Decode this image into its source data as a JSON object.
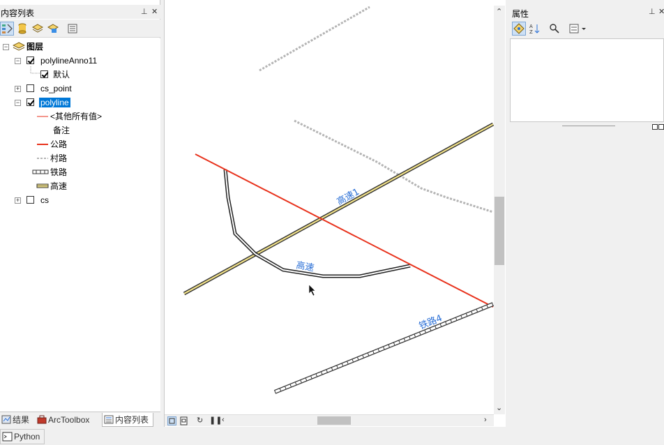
{
  "toc": {
    "title": "内容列表",
    "pin_glyph": "⊥",
    "close_glyph": "✕",
    "tree": {
      "root_label": "图层",
      "anno_layer": "polylineAnno11",
      "anno_class": "默认",
      "point_layer": "cs_point",
      "line_layer": "polyline",
      "legend": [
        {
          "label": "<其他所有值>",
          "style": "thin-red"
        },
        {
          "label": "备注",
          "style": "none"
        },
        {
          "label": "公路",
          "style": "red"
        },
        {
          "label": "村路",
          "style": "gray-dash"
        },
        {
          "label": "铁路",
          "style": "rail"
        },
        {
          "label": "高速",
          "style": "highway"
        }
      ],
      "cs_layer": "cs"
    },
    "tabs": [
      "结果",
      "ArcToolbox",
      "内容列表"
    ],
    "python_tab": "Python"
  },
  "map": {
    "labels": {
      "highway1": "高速1",
      "highway2": "高速",
      "railway": "铁路4"
    }
  },
  "properties": {
    "title": "属性"
  },
  "colors": {
    "highway_fill": "#f2e28a",
    "road": "#e8321c",
    "village_road": "#b4b4b4",
    "label_blue": "#2a6fd6",
    "selection": "#0078d7"
  }
}
